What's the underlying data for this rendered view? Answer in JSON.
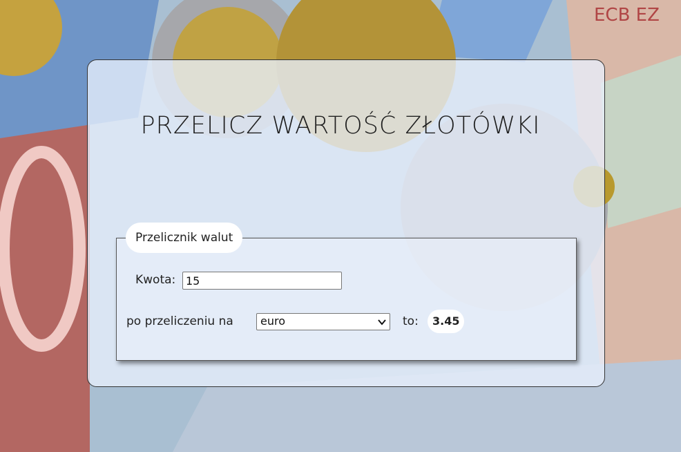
{
  "page": {
    "title": "PRZELICZ WARTOŚĆ ZŁOTÓWKI"
  },
  "converter": {
    "legend": "Przelicznik walut",
    "amount_label": "Kwota:",
    "amount_value": "15",
    "convert_label": "po przeliczeniu na",
    "currency_selected": "euro",
    "result_label": "to:",
    "result_value": "3.45"
  },
  "icons": {
    "select_arrow": "chevron-down-icon"
  },
  "colors": {
    "card_background": "#e8f0fc",
    "text": "#222222",
    "pill_background": "#ffffff"
  }
}
